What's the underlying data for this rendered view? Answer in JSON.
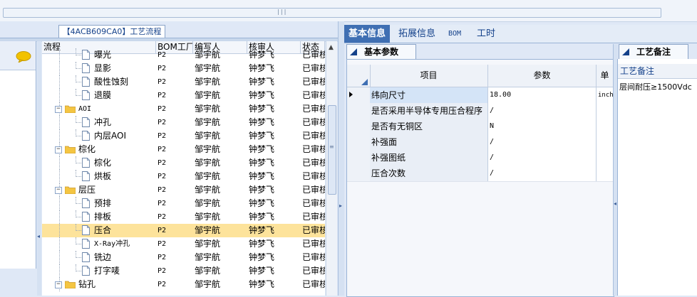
{
  "process_tab": "【4ACB609CA0】工艺流程",
  "tree": {
    "columns": [
      "流程",
      "BOM工厂",
      "编写人",
      "核审人",
      "状态"
    ],
    "rows": [
      {
        "level": 2,
        "kind": "doc",
        "name": "曝光",
        "factory": "P2",
        "writer": "邹宇航",
        "reviewer": "钟梦飞",
        "status": "已审核",
        "selected": false
      },
      {
        "level": 2,
        "kind": "doc",
        "name": "显影",
        "factory": "P2",
        "writer": "邹宇航",
        "reviewer": "钟梦飞",
        "status": "已审核",
        "selected": false
      },
      {
        "level": 2,
        "kind": "doc",
        "name": "酸性蚀刻",
        "factory": "P2",
        "writer": "邹宇航",
        "reviewer": "钟梦飞",
        "status": "已审核",
        "selected": false
      },
      {
        "level": 2,
        "kind": "doc",
        "name": "退膜",
        "factory": "P2",
        "writer": "邹宇航",
        "reviewer": "钟梦飞",
        "status": "已审核",
        "selected": false
      },
      {
        "level": 1,
        "kind": "folder",
        "name": "AOI",
        "factory": "P2",
        "writer": "邹宇航",
        "reviewer": "钟梦飞",
        "status": "已审核",
        "selected": false
      },
      {
        "level": 2,
        "kind": "doc",
        "name": "冲孔",
        "factory": "P2",
        "writer": "邹宇航",
        "reviewer": "钟梦飞",
        "status": "已审核",
        "selected": false
      },
      {
        "level": 2,
        "kind": "doc",
        "name": "内层AOI",
        "factory": "P2",
        "writer": "邹宇航",
        "reviewer": "钟梦飞",
        "status": "已审核",
        "selected": false
      },
      {
        "level": 1,
        "kind": "folder",
        "name": "棕化",
        "factory": "P2",
        "writer": "邹宇航",
        "reviewer": "钟梦飞",
        "status": "已审核",
        "selected": false
      },
      {
        "level": 2,
        "kind": "doc",
        "name": "棕化",
        "factory": "P2",
        "writer": "邹宇航",
        "reviewer": "钟梦飞",
        "status": "已审核",
        "selected": false
      },
      {
        "level": 2,
        "kind": "doc",
        "name": "烘板",
        "factory": "P2",
        "writer": "邹宇航",
        "reviewer": "钟梦飞",
        "status": "已审核",
        "selected": false
      },
      {
        "level": 1,
        "kind": "folder",
        "name": "层压",
        "factory": "P2",
        "writer": "邹宇航",
        "reviewer": "钟梦飞",
        "status": "已审核",
        "selected": false
      },
      {
        "level": 2,
        "kind": "doc",
        "name": "预排",
        "factory": "P2",
        "writer": "邹宇航",
        "reviewer": "钟梦飞",
        "status": "已审核",
        "selected": false
      },
      {
        "level": 2,
        "kind": "doc",
        "name": "排板",
        "factory": "P2",
        "writer": "邹宇航",
        "reviewer": "钟梦飞",
        "status": "已审核",
        "selected": false
      },
      {
        "level": 2,
        "kind": "doc",
        "name": "压合",
        "factory": "P2",
        "writer": "邹宇航",
        "reviewer": "钟梦飞",
        "status": "已审核",
        "selected": true
      },
      {
        "level": 2,
        "kind": "doc",
        "name": "X-Ray冲孔",
        "factory": "P2",
        "writer": "邹宇航",
        "reviewer": "钟梦飞",
        "status": "已审核",
        "selected": false
      },
      {
        "level": 2,
        "kind": "doc",
        "name": "铣边",
        "factory": "P2",
        "writer": "邹宇航",
        "reviewer": "钟梦飞",
        "status": "已审核",
        "selected": false
      },
      {
        "level": 2,
        "kind": "doc",
        "name": "打字唛",
        "factory": "P2",
        "writer": "邹宇航",
        "reviewer": "钟梦飞",
        "status": "已审核",
        "selected": false
      },
      {
        "level": 1,
        "kind": "folder",
        "name": "钻孔",
        "factory": "P2",
        "writer": "邹宇航",
        "reviewer": "钟梦飞",
        "status": "已审核",
        "selected": false
      }
    ]
  },
  "main_tabs": [
    {
      "label": "基本信息",
      "active": true
    },
    {
      "label": "拓展信息",
      "active": false
    },
    {
      "label": "BOM",
      "active": false
    },
    {
      "label": "工时",
      "active": false
    }
  ],
  "params": {
    "tab_label": "基本参数",
    "col_item": "项目",
    "col_value": "参数",
    "col_extra": "单",
    "rows": [
      {
        "item": "纬向尺寸",
        "value": "18.00",
        "extra": "inch",
        "current": true
      },
      {
        "item": "是否采用半导体专用压合程序",
        "value": "/",
        "extra": "",
        "current": false
      },
      {
        "item": "是否有无铜区",
        "value": "N",
        "extra": "",
        "current": false
      },
      {
        "item": "补强面",
        "value": "/",
        "extra": "",
        "current": false
      },
      {
        "item": "补强图纸",
        "value": "/",
        "extra": "",
        "current": false
      },
      {
        "item": "压合次数",
        "value": "/",
        "extra": "",
        "current": false
      }
    ]
  },
  "notes": {
    "tab_label": "工艺备注",
    "header": "工艺备注",
    "text": "层间耐压≥1500Vdc"
  }
}
